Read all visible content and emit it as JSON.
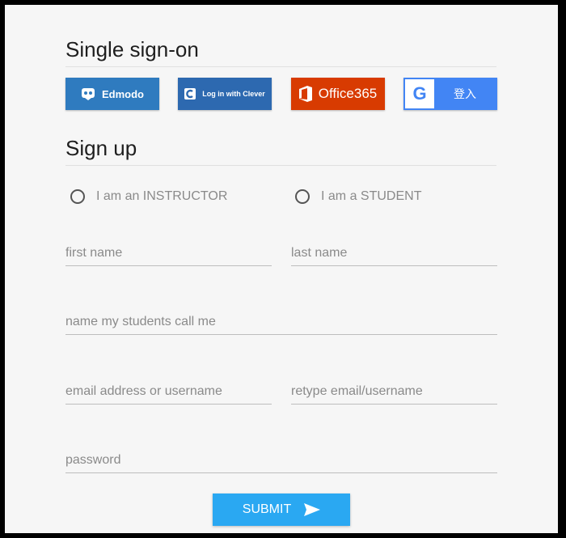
{
  "sso": {
    "heading": "Single sign-on",
    "edmodo_label": "Edmodo",
    "clever_label": "Log in with Clever",
    "office_label": "Office365",
    "google_letter": "G",
    "google_label": "登入"
  },
  "signup": {
    "heading": "Sign up",
    "radio_instructor": "I am an INSTRUCTOR",
    "radio_student": "I am a STUDENT",
    "first_name_placeholder": "first name",
    "last_name_placeholder": "last name",
    "display_name_placeholder": "name my students call me",
    "email_placeholder": "email address or username",
    "retype_email_placeholder": "retype email/username",
    "password_placeholder": "password",
    "submit_label": "SUBMIT"
  },
  "colors": {
    "edmodo": "#2f7bbf",
    "clever": "#2d69b0",
    "office": "#d83b01",
    "google": "#4285f4",
    "submit": "#2aa8f2"
  },
  "icons": {
    "edmodo": "edmodo-logo-icon",
    "clever": "clever-logo-icon",
    "office": "office-logo-icon",
    "google": "google-logo-icon",
    "submit": "send-icon"
  }
}
